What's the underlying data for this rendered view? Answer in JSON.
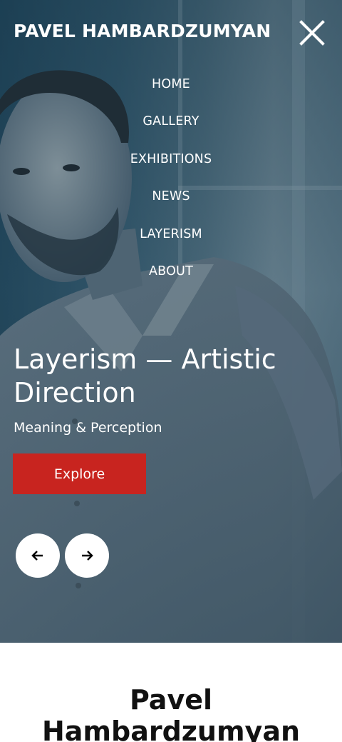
{
  "header": {
    "brand": "PAVEL HAMBARDZUMYAN",
    "close_icon": "close-icon"
  },
  "nav": {
    "items": [
      {
        "label": "HOME"
      },
      {
        "label": "GALLERY"
      },
      {
        "label": "EXHIBITIONS"
      },
      {
        "label": "NEWS"
      },
      {
        "label": "LAYERISM"
      },
      {
        "label": "ABOUT"
      }
    ]
  },
  "hero": {
    "title": "Layerism — Artistic Direction",
    "subtitle": "Meaning & Perception",
    "cta_label": "Explore",
    "prev_icon": "arrow-left-icon",
    "next_icon": "arrow-right-icon"
  },
  "about": {
    "title": "Pavel Hambardzumyan"
  },
  "colors": {
    "accent": "#c8241f",
    "overlay": "#1e4a5e",
    "text_light": "#ffffff",
    "text_dark": "#111111"
  }
}
